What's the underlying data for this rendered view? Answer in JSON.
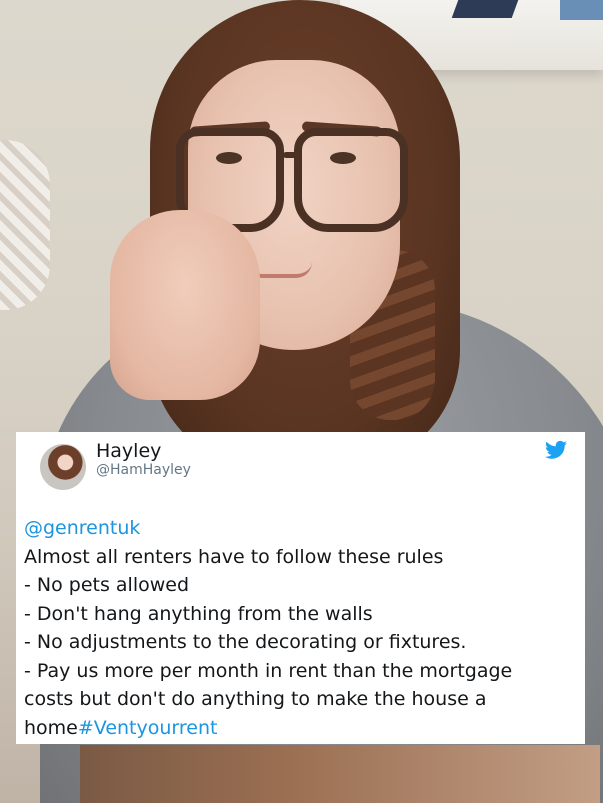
{
  "tweet": {
    "author_name": "Hayley",
    "author_handle": "@HamHayley",
    "mention": "@genrentuk",
    "lines": [
      "Almost all renters have to follow these rules",
      "- No pets allowed",
      "- Don't hang anything from the walls",
      "- No adjustments to the decorating or fixtures.",
      "- Pay us more per month in rent than the mortgage",
      "costs but don't do anything to make the house a"
    ],
    "last_line_text": "home",
    "hashtag": "#Ventyourrent",
    "bird_icon": "twitter-bird-icon",
    "link_color": "#1b95e0",
    "bird_color": "#1da1f2"
  }
}
